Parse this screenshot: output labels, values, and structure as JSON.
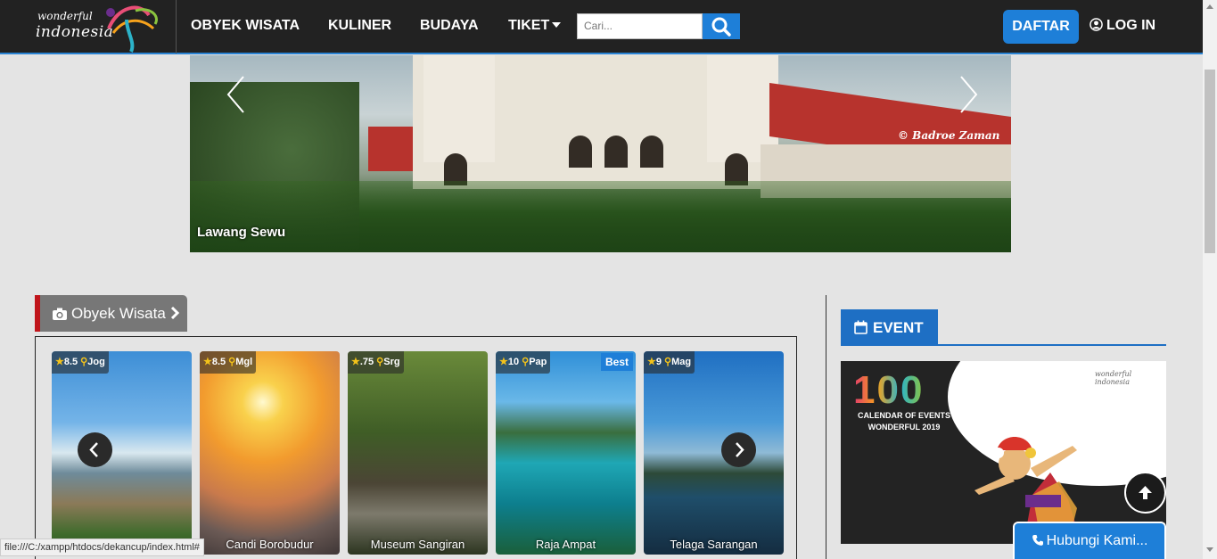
{
  "logo": {
    "line1": "wonderful",
    "line2": "indonesia"
  },
  "nav": {
    "items": [
      {
        "label": "OBYEK WISATA"
      },
      {
        "label": "KULINER"
      },
      {
        "label": "BUDAYA"
      },
      {
        "label": "TIKET"
      }
    ],
    "search_placeholder": "Cari...",
    "daftar": "DAFTAR",
    "login": "LOG IN"
  },
  "hero": {
    "caption": "Lawang Sewu",
    "credit": "© Badroe Zaman"
  },
  "section": {
    "title": "Obyek Wisata"
  },
  "cards": [
    {
      "rating": "8.5",
      "region": "Jog",
      "name": "",
      "best": ""
    },
    {
      "rating": "8.5",
      "region": "Mgl",
      "name": "Candi Borobudur",
      "best": ""
    },
    {
      "rating": ".75",
      "region": "Srg",
      "name": "Museum Sangiran",
      "best": ""
    },
    {
      "rating": "10",
      "region": "Pap",
      "name": "Raja Ampat",
      "best": "Best"
    },
    {
      "rating": "9",
      "region": "Mag",
      "name": "Telaga Sarangan",
      "best": ""
    }
  ],
  "event": {
    "title": "EVENT",
    "banner_number": "100",
    "banner_line1": "CALENDAR OF EVENTS",
    "banner_line2": "WONDERFUL 2019",
    "banner_brand1": "wonderful",
    "banner_brand2": "indonesia"
  },
  "contact": {
    "label": "Hubungi Kami..."
  },
  "status_url": "file:///C:/xampp/htdocs/dekancup/index.html#",
  "colors": {
    "accent": "#1e7fd8",
    "nav_bg": "#222222",
    "section_red": "#c0151b"
  }
}
